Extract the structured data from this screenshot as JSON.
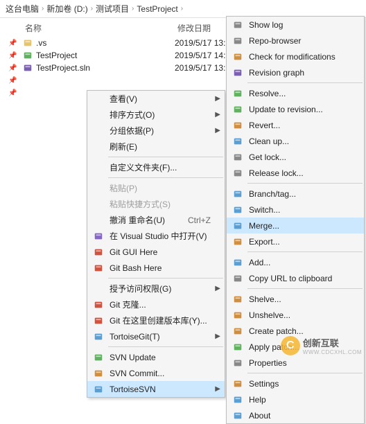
{
  "breadcrumb": [
    "这台电脑",
    "新加卷 (D:)",
    "测试项目",
    "TestProject"
  ],
  "columns": {
    "name": "名称",
    "date": "修改日期"
  },
  "files": [
    {
      "icon": "folder-hidden",
      "name": ".vs",
      "date": "2019/5/17 13:"
    },
    {
      "icon": "folder-green",
      "name": "TestProject",
      "date": "2019/5/17 14:"
    },
    {
      "icon": "sln",
      "name": "TestProject.sln",
      "date": "2019/5/17 13:"
    }
  ],
  "menu1": [
    {
      "type": "item",
      "label": "查看(V)",
      "arrow": true
    },
    {
      "type": "item",
      "label": "排序方式(O)",
      "arrow": true
    },
    {
      "type": "item",
      "label": "分组依据(P)",
      "arrow": true
    },
    {
      "type": "item",
      "label": "刷新(E)"
    },
    {
      "type": "sep"
    },
    {
      "type": "item",
      "label": "自定义文件夹(F)..."
    },
    {
      "type": "sep"
    },
    {
      "type": "item",
      "label": "粘贴(P)",
      "disabled": true
    },
    {
      "type": "item",
      "label": "粘贴快捷方式(S)",
      "disabled": true
    },
    {
      "type": "item",
      "label": "撤消 重命名(U)",
      "shortcut": "Ctrl+Z"
    },
    {
      "type": "item",
      "label": "在 Visual Studio 中打开(V)",
      "icon": "vs"
    },
    {
      "type": "item",
      "label": "Git GUI Here",
      "icon": "git"
    },
    {
      "type": "item",
      "label": "Git Bash Here",
      "icon": "git"
    },
    {
      "type": "sep"
    },
    {
      "type": "item",
      "label": "授予访问权限(G)",
      "arrow": true
    },
    {
      "type": "item",
      "label": "Git 克隆...",
      "icon": "git-clone"
    },
    {
      "type": "item",
      "label": "Git 在这里创建版本库(Y)...",
      "icon": "git-create"
    },
    {
      "type": "item",
      "label": "TortoiseGit(T)",
      "icon": "tortoise-git",
      "arrow": true
    },
    {
      "type": "sep"
    },
    {
      "type": "item",
      "label": "SVN Update",
      "icon": "svn-update"
    },
    {
      "type": "item",
      "label": "SVN Commit...",
      "icon": "svn-commit"
    },
    {
      "type": "item",
      "label": "TortoiseSVN",
      "icon": "tortoise-svn",
      "arrow": true,
      "hover": true
    }
  ],
  "menu2": [
    {
      "type": "item",
      "label": "Show log",
      "icon": "log"
    },
    {
      "type": "item",
      "label": "Repo-browser",
      "icon": "repo"
    },
    {
      "type": "item",
      "label": "Check for modifications",
      "icon": "check-mod"
    },
    {
      "type": "item",
      "label": "Revision graph",
      "icon": "rev-graph"
    },
    {
      "type": "sep"
    },
    {
      "type": "item",
      "label": "Resolve...",
      "icon": "resolve"
    },
    {
      "type": "item",
      "label": "Update to revision...",
      "icon": "update-rev"
    },
    {
      "type": "item",
      "label": "Revert...",
      "icon": "revert"
    },
    {
      "type": "item",
      "label": "Clean up...",
      "icon": "cleanup"
    },
    {
      "type": "item",
      "label": "Get lock...",
      "icon": "lock"
    },
    {
      "type": "item",
      "label": "Release lock...",
      "icon": "unlock"
    },
    {
      "type": "sep"
    },
    {
      "type": "item",
      "label": "Branch/tag...",
      "icon": "branch"
    },
    {
      "type": "item",
      "label": "Switch...",
      "icon": "switch"
    },
    {
      "type": "item",
      "label": "Merge...",
      "icon": "merge",
      "hover": true
    },
    {
      "type": "item",
      "label": "Export...",
      "icon": "export"
    },
    {
      "type": "sep"
    },
    {
      "type": "item",
      "label": "Add...",
      "icon": "add"
    },
    {
      "type": "item",
      "label": "Copy URL to clipboard",
      "icon": "copy"
    },
    {
      "type": "sep"
    },
    {
      "type": "item",
      "label": "Shelve...",
      "icon": "shelve"
    },
    {
      "type": "item",
      "label": "Unshelve...",
      "icon": "unshelve"
    },
    {
      "type": "item",
      "label": "Create patch...",
      "icon": "create-patch"
    },
    {
      "type": "item",
      "label": "Apply patch...",
      "icon": "apply-patch"
    },
    {
      "type": "item",
      "label": "Properties",
      "icon": "properties"
    },
    {
      "type": "sep"
    },
    {
      "type": "item",
      "label": "Settings",
      "icon": "settings"
    },
    {
      "type": "item",
      "label": "Help",
      "icon": "help"
    },
    {
      "type": "item",
      "label": "About",
      "icon": "about"
    }
  ],
  "watermark": {
    "main": "创新互联",
    "sub": "WWW.CDCXHL.COM"
  }
}
